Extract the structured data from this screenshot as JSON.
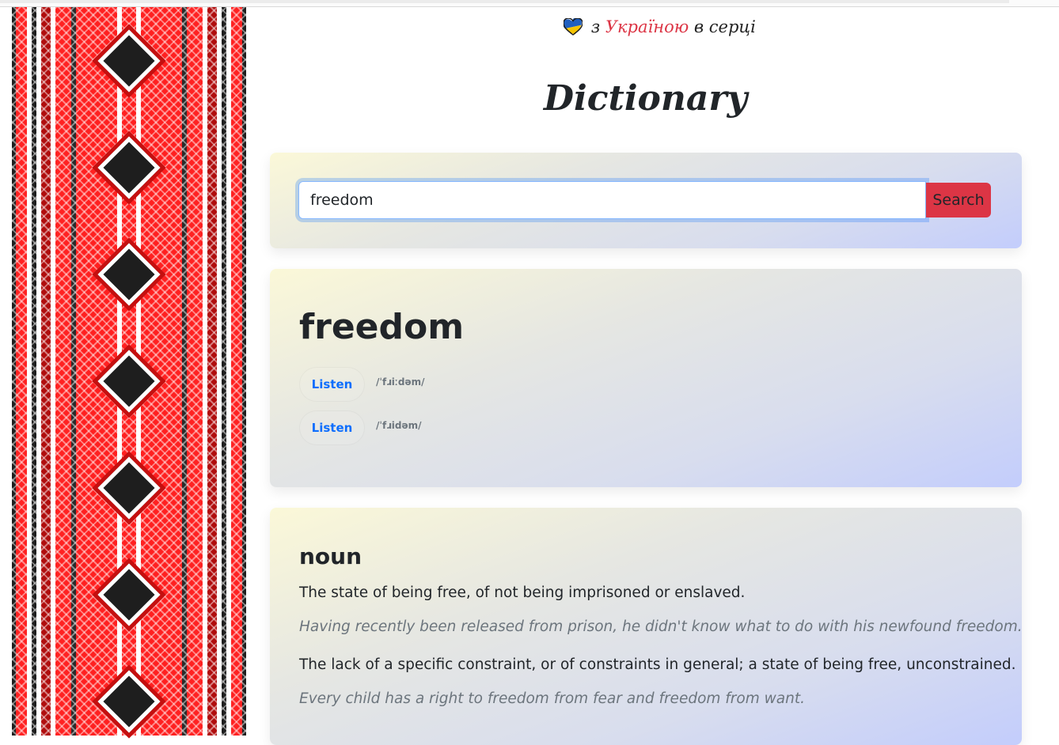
{
  "header": {
    "slogan_prefix": "з",
    "slogan_country": "Україною",
    "slogan_suffix": "в серці",
    "title": "Dictionary"
  },
  "search": {
    "value": "freedom",
    "button_label": "Search"
  },
  "entry": {
    "word": "freedom",
    "phonetics": [
      {
        "listen_label": "Listen",
        "text": "/ˈfɹiːdəm/"
      },
      {
        "listen_label": "Listen",
        "text": "/ˈfɹidəm/"
      }
    ]
  },
  "meaning": {
    "part_of_speech": "noun",
    "definitions": [
      {
        "definition": "The state of being free, of not being imprisoned or enslaved.",
        "example": "Having recently been released from prison, he didn't know what to do with his newfound freedom."
      },
      {
        "definition": "The lack of a specific constraint, or of constraints in general; a state of being free, unconstrained.",
        "example": "Every child has a right to freedom from fear and freedom from want."
      }
    ]
  },
  "colors": {
    "accent": "#dc3545",
    "link": "#0d6efd",
    "muted": "#6c757d",
    "ornament_red": "#ff2020",
    "ornament_dark": "#1e1e1e"
  },
  "icons": {
    "heart": "ukraine-heart-icon",
    "ornament": "vyshyvanka-ornament"
  }
}
